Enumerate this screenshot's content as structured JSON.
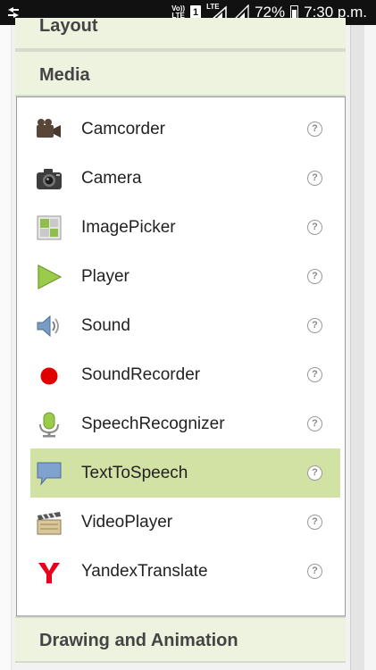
{
  "status_bar": {
    "volte_line1": "Vo))",
    "volte_line2": "LTE",
    "sim_slot": "1",
    "lte_label": "LTE",
    "battery_percent": "72%",
    "time": "7:30 p.m."
  },
  "palette": {
    "categories": {
      "layout": "Layout",
      "media": "Media",
      "drawing": "Drawing and Animation"
    },
    "help_glyph": "?",
    "selected_item": "TextToSpeech",
    "items": [
      {
        "label": "Camcorder",
        "icon": "camcorder-icon"
      },
      {
        "label": "Camera",
        "icon": "camera-icon"
      },
      {
        "label": "ImagePicker",
        "icon": "image-picker-icon"
      },
      {
        "label": "Player",
        "icon": "play-icon"
      },
      {
        "label": "Sound",
        "icon": "speaker-icon"
      },
      {
        "label": "SoundRecorder",
        "icon": "record-icon"
      },
      {
        "label": "SpeechRecognizer",
        "icon": "microphone-icon"
      },
      {
        "label": "TextToSpeech",
        "icon": "speech-bubble-icon"
      },
      {
        "label": "VideoPlayer",
        "icon": "clapperboard-icon"
      },
      {
        "label": "YandexTranslate",
        "icon": "yandex-icon"
      }
    ]
  },
  "colors": {
    "selected_highlight": "#d2e2a4",
    "category_background": "#eef3df",
    "record_red": "#e00000"
  }
}
